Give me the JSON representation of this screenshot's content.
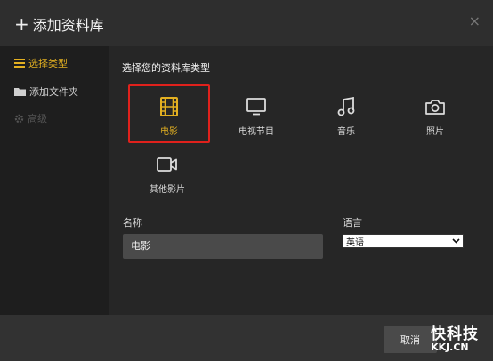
{
  "dialog": {
    "title": "添加资料库",
    "close_symbol": "×"
  },
  "sidebar": {
    "items": [
      {
        "label": "选择类型",
        "icon": "list-icon",
        "state": "active"
      },
      {
        "label": "添加文件夹",
        "icon": "folder-icon",
        "state": "normal"
      },
      {
        "label": "高级",
        "icon": "gear-icon",
        "state": "disabled"
      }
    ]
  },
  "main": {
    "section_title": "选择您的资料库类型",
    "types": [
      {
        "label": "电影",
        "icon": "film-icon",
        "selected": true
      },
      {
        "label": "电视节目",
        "icon": "tv-icon",
        "selected": false
      },
      {
        "label": "音乐",
        "icon": "music-icon",
        "selected": false
      },
      {
        "label": "照片",
        "icon": "camera-icon",
        "selected": false
      },
      {
        "label": "其他影片",
        "icon": "video-camera-icon",
        "selected": false
      }
    ],
    "name_label": "名称",
    "name_value": "电影",
    "language_label": "语言",
    "language_value": "英语"
  },
  "footer": {
    "cancel_label": "取消",
    "watermark_line1": "快科技",
    "watermark_line2": "KKJ.CN"
  },
  "colors": {
    "accent": "#e3b021",
    "selection_border": "#e0211c"
  }
}
